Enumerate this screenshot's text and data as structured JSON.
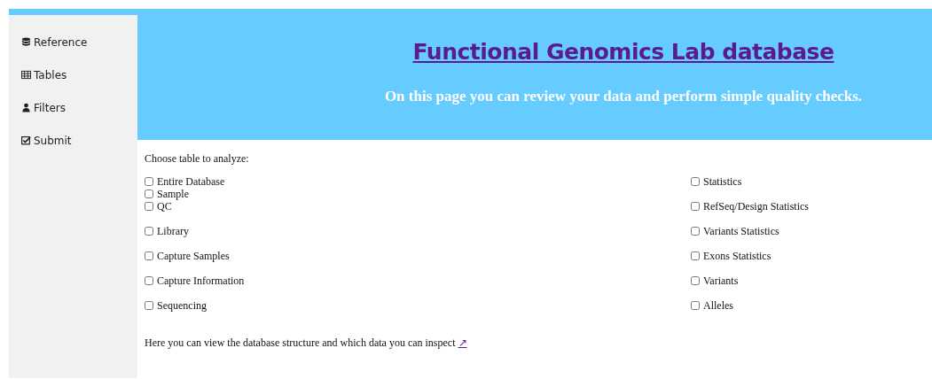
{
  "sidebar": {
    "items": [
      {
        "label": "Reference"
      },
      {
        "label": "Tables"
      },
      {
        "label": "Filters"
      },
      {
        "label": "Submit"
      }
    ]
  },
  "header": {
    "title": "Functional Genomics Lab database",
    "subtitle": "On this page you can review your data and perform simple quality checks."
  },
  "form": {
    "prompt": "Choose table to analyze:",
    "columns": [
      {
        "groups": [
          {
            "items": [
              {
                "label": "Entire Database",
                "checked": false
              },
              {
                "label": "Sample",
                "checked": false
              },
              {
                "label": "QC",
                "checked": false
              }
            ]
          },
          {
            "items": [
              {
                "label": "Library",
                "checked": false
              }
            ]
          },
          {
            "items": [
              {
                "label": "Capture Samples",
                "checked": false
              }
            ]
          },
          {
            "items": [
              {
                "label": "Capture Information",
                "checked": false
              }
            ]
          },
          {
            "items": [
              {
                "label": "Sequencing",
                "checked": false
              }
            ]
          }
        ]
      },
      {
        "groups": [
          {
            "items": [
              {
                "label": "Statistics",
                "checked": false
              }
            ]
          },
          {
            "items": [
              {
                "label": "RefSeq/Design Statistics",
                "checked": false
              }
            ]
          },
          {
            "items": [
              {
                "label": "Variants Statistics",
                "checked": false
              }
            ]
          },
          {
            "items": [
              {
                "label": "Exons Statistics",
                "checked": false
              }
            ]
          },
          {
            "items": [
              {
                "label": "Variants",
                "checked": false
              }
            ]
          },
          {
            "items": [
              {
                "label": "Alleles",
                "checked": false
              }
            ]
          }
        ]
      }
    ]
  },
  "note": {
    "text": "Here you can view the database structure and which data you can inspect",
    "link": "↗"
  }
}
